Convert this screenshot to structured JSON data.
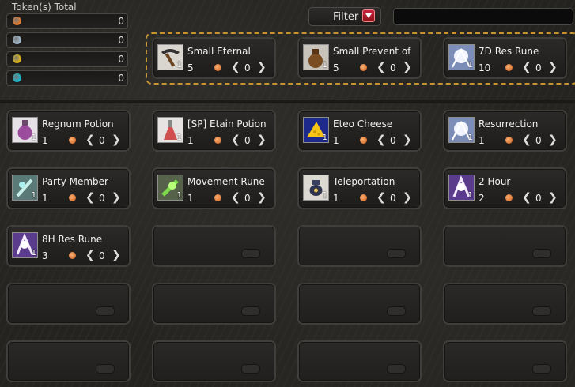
{
  "tokens": {
    "title": "Token(s) Total",
    "rows": [
      {
        "icon": "orange-token-icon",
        "color": "#e07a30",
        "value": "0"
      },
      {
        "icon": "silver-token-icon",
        "color": "#9fb6c8",
        "value": "0"
      },
      {
        "icon": "gold-token-icon",
        "color": "#d8b21c",
        "value": "0"
      },
      {
        "icon": "cyan-token-icon",
        "color": "#1fb3c2",
        "value": "0"
      }
    ]
  },
  "filter": {
    "label": "Filter",
    "arrow_icon": "dropdown-arrow-icon"
  },
  "search": {
    "value": ""
  },
  "featured": [
    {
      "name": "Small Eternal",
      "icon": "pickaxe-icon",
      "stack": "1",
      "count": "5",
      "qty": "0"
    },
    {
      "name": "Small Prevent of",
      "icon": "pouch-icon",
      "stack": "1",
      "count": "5",
      "qty": "0"
    },
    {
      "name": "7D Res Rune",
      "icon": "res-rune-icon",
      "stack": "1",
      "count": "10",
      "qty": "0"
    }
  ],
  "items": [
    {
      "name": "Regnum Potion",
      "icon": "purple-potion-icon",
      "stack": "1",
      "count": "1",
      "qty": "0"
    },
    {
      "name": "[SP] Etain Potion",
      "icon": "red-potion-icon",
      "stack": "1",
      "count": "1",
      "qty": "0"
    },
    {
      "name": "Eteo Cheese",
      "icon": "cheese-icon",
      "stack": "1",
      "count": "1",
      "qty": "0"
    },
    {
      "name": "Resurrection",
      "icon": "res-rune-icon",
      "stack": "1",
      "count": "1",
      "qty": "0"
    },
    {
      "name": "Party Member",
      "icon": "party-member-icon",
      "stack": "1",
      "count": "1",
      "qty": "0"
    },
    {
      "name": "Movement Rune",
      "icon": "movement-rune-icon",
      "stack": "1",
      "count": "1",
      "qty": "0"
    },
    {
      "name": "Teleportation",
      "icon": "teleport-urn-icon",
      "stack": "1",
      "count": "1",
      "qty": "0"
    },
    {
      "name": "2 Hour",
      "icon": "purple-rune-icon",
      "stack": "1",
      "count": "2",
      "qty": "0"
    },
    {
      "name": "8H Res Rune",
      "icon": "purple-rune-icon",
      "stack": "1",
      "count": "3",
      "qty": "0"
    }
  ],
  "arrows": {
    "left": "❮",
    "right": "❯"
  },
  "colors": {
    "dashed_border": "#c8922e",
    "coin": "#d86b24"
  }
}
